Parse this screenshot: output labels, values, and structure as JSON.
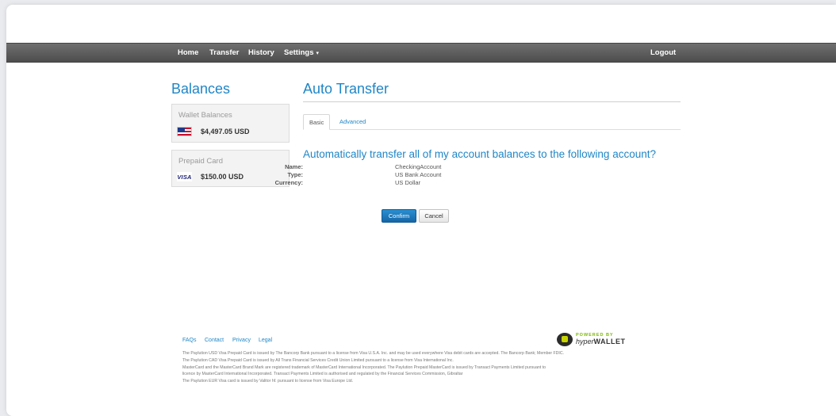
{
  "nav": {
    "items": [
      {
        "label": "Home"
      },
      {
        "label": "Transfer"
      },
      {
        "label": "History"
      },
      {
        "label": "Settings"
      }
    ],
    "settings_caret": "▾",
    "logout": "Logout"
  },
  "balances": {
    "title": "Balances",
    "panels": [
      {
        "title": "Wallet Balances",
        "icon": "us-flag-icon",
        "amount": "$4,497.05 USD"
      },
      {
        "title": "Prepaid Card",
        "icon": "visa-icon",
        "icon_text": "VISA",
        "amount": "$150.00 USD"
      }
    ]
  },
  "auto_transfer": {
    "title": "Auto Transfer",
    "tabs": [
      {
        "label": "Basic",
        "active": true
      },
      {
        "label": "Advanced",
        "active": false
      }
    ],
    "question": "Automatically transfer all of my account balances to the following account?",
    "details": [
      {
        "label": "Name:",
        "value": "CheckingAccount"
      },
      {
        "label": "Type:",
        "value": "US Bank Account"
      },
      {
        "label": "Currency:",
        "value": "US Dollar"
      }
    ],
    "confirm": "Confirm",
    "cancel": "Cancel"
  },
  "footer": {
    "links": [
      "FAQs",
      "Contact",
      "Privacy",
      "Legal"
    ],
    "powered_by": "POWERED BY",
    "brand_light": "hyper",
    "brand_bold": "WALLET",
    "legal_lines": [
      "The Paylution USD Visa Prepaid Card is issued by The Bancorp Bank pursuant to a license from Visa U.S.A. Inc. and may be used everywhere Visa debit cards are accepted. The Bancorp Bank; Member FDIC.",
      "The Paylution CAD Visa Prepaid Card is issued by All Trans Financial Services Credit Union Limited pursuant to a license from Visa International Inc.",
      "MasterCard and the MasterCard Brand Mark are registered trademark of MasterCard International Incorporated. The Paylution Prepaid MasterCard is issued by Transact Payments Limited pursuant to",
      "licence by MasterCard International Incorporated. Transact Payments Limited is authorised and regulated by the Financial Services Commission, Gibraltar",
      "The Paylution EUR Visa card is issued by Valitor hf. pursuant to license from Visa Europe Ltd."
    ]
  },
  "colors": {
    "accent": "#1f86c7",
    "navbar": "#5a5a5a",
    "confirm": "#1a76b9"
  }
}
